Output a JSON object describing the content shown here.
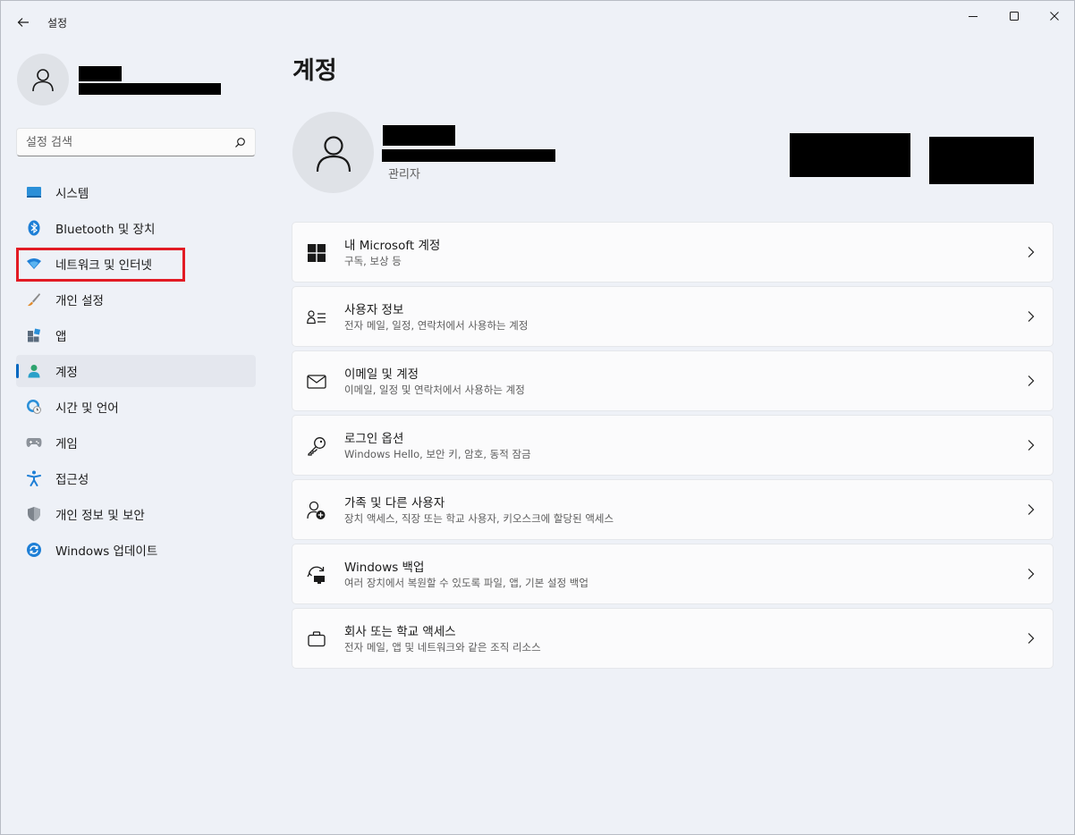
{
  "window": {
    "title": "설정",
    "controls": {
      "minimize": "minimize",
      "maximize": "maximize",
      "close": "close"
    }
  },
  "sidebar": {
    "search_placeholder": "설정 검색",
    "items": [
      {
        "label": "시스템",
        "icon": "system-icon"
      },
      {
        "label": "Bluetooth 및 장치",
        "icon": "bluetooth-icon"
      },
      {
        "label": "네트워크 및 인터넷",
        "icon": "network-icon"
      },
      {
        "label": "개인 설정",
        "icon": "brush-icon"
      },
      {
        "label": "앱",
        "icon": "apps-icon"
      },
      {
        "label": "계정",
        "icon": "account-icon",
        "active": true
      },
      {
        "label": "시간 및 언어",
        "icon": "time-language-icon"
      },
      {
        "label": "게임",
        "icon": "gamepad-icon"
      },
      {
        "label": "접근성",
        "icon": "accessibility-icon"
      },
      {
        "label": "개인 정보 및 보안",
        "icon": "shield-icon"
      },
      {
        "label": "Windows 업데이트",
        "icon": "update-icon"
      }
    ]
  },
  "main": {
    "title": "계정",
    "user": {
      "role": "관리자"
    },
    "cards": [
      {
        "title": "내 Microsoft 계정",
        "subtitle": "구독, 보상 등",
        "icon": "windows-logo-icon"
      },
      {
        "title": "사용자 정보",
        "subtitle": "전자 메일, 일정, 연락처에서 사용하는 계정",
        "icon": "user-info-icon"
      },
      {
        "title": "이메일 및 계정",
        "subtitle": "이메일, 일정 및 연락처에서 사용하는 계정",
        "icon": "mail-icon"
      },
      {
        "title": "로그인 옵션",
        "subtitle": "Windows Hello, 보안 키, 암호, 동적 잠금",
        "icon": "key-icon"
      },
      {
        "title": "가족 및 다른 사용자",
        "subtitle": "장치 액세스, 직장 또는 학교 사용자, 키오스크에 할당된 액세스",
        "icon": "add-user-icon"
      },
      {
        "title": "Windows 백업",
        "subtitle": "여러 장치에서 복원할 수 있도록 파일, 앱, 기본 설정 백업",
        "icon": "backup-icon"
      },
      {
        "title": "회사 또는 학교 액세스",
        "subtitle": "전자 메일, 앱 및 네트워크와 같은 조직 리소스",
        "icon": "briefcase-icon"
      }
    ]
  },
  "colors": {
    "accent": "#0067c0",
    "highlight": "#e21b24",
    "background": "#eef1f7"
  }
}
